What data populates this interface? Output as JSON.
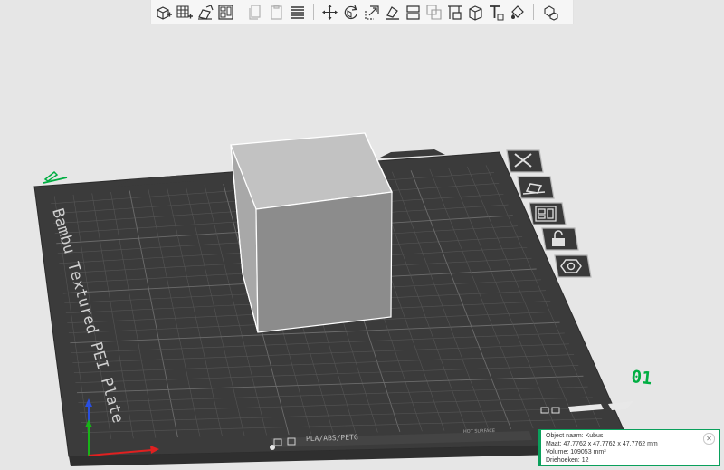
{
  "toolbar": {
    "groups": [
      [
        {
          "name": "add-object-button",
          "icon": "cube-plus-icon"
        },
        {
          "name": "add-plate-button",
          "icon": "grid-plus-icon"
        },
        {
          "name": "auto-orient-button",
          "icon": "orient-icon"
        },
        {
          "name": "arrange-button",
          "icon": "arrange-icon"
        }
      ],
      [
        {
          "name": "copy-button",
          "icon": "copy-icon",
          "disabled": true
        },
        {
          "name": "paste-button",
          "icon": "paste-icon",
          "disabled": true
        },
        {
          "name": "layers-button",
          "icon": "layers-icon"
        }
      ],
      [
        {
          "name": "move-button",
          "icon": "move-icon"
        },
        {
          "name": "rotate-button",
          "icon": "rotate-icon"
        },
        {
          "name": "scale-button",
          "icon": "scale-icon"
        },
        {
          "name": "lay-on-face-button",
          "icon": "lay-on-face-icon"
        },
        {
          "name": "cut-button",
          "icon": "cut-icon"
        },
        {
          "name": "boolean-button",
          "icon": "boolean-icon"
        },
        {
          "name": "support-paint-button",
          "icon": "support-paint-icon"
        },
        {
          "name": "seam-paint-button",
          "icon": "seam-icon"
        },
        {
          "name": "text-button",
          "icon": "text-icon"
        },
        {
          "name": "color-paint-button",
          "icon": "paint-bucket-icon"
        }
      ],
      [
        {
          "name": "assembly-view-button",
          "icon": "assembly-icon"
        }
      ]
    ]
  },
  "plate": {
    "name": "Bambu Textured PEI Plate",
    "number": "01",
    "filament_label": "PLA/ABS/PETG",
    "surface_label": "HOT SURFACE"
  },
  "plate_tools": [
    {
      "name": "delete-plate-button",
      "icon": "close-icon"
    },
    {
      "name": "plate-orient-button",
      "icon": "orient-icon"
    },
    {
      "name": "plate-arrange-button",
      "icon": "arrange-icon"
    },
    {
      "name": "lock-plate-button",
      "icon": "lock-icon"
    },
    {
      "name": "plate-settings-button",
      "icon": "hexagon-nut-icon"
    }
  ],
  "colors": {
    "accent": "#00ae42",
    "plate": "#3b3b3b",
    "cube_front": "#b4b4b4",
    "cube_right": "#8c8c8c",
    "cube_top": "#c2c2c2"
  },
  "info": {
    "line1": "Object naam: Kubus",
    "line2": "Maat: 47.7762 x 47.7762 x 47.7762 mm",
    "line3": "Volume: 109053 mm³",
    "line4": "Driehoeken: 12",
    "close_label": "✕"
  }
}
